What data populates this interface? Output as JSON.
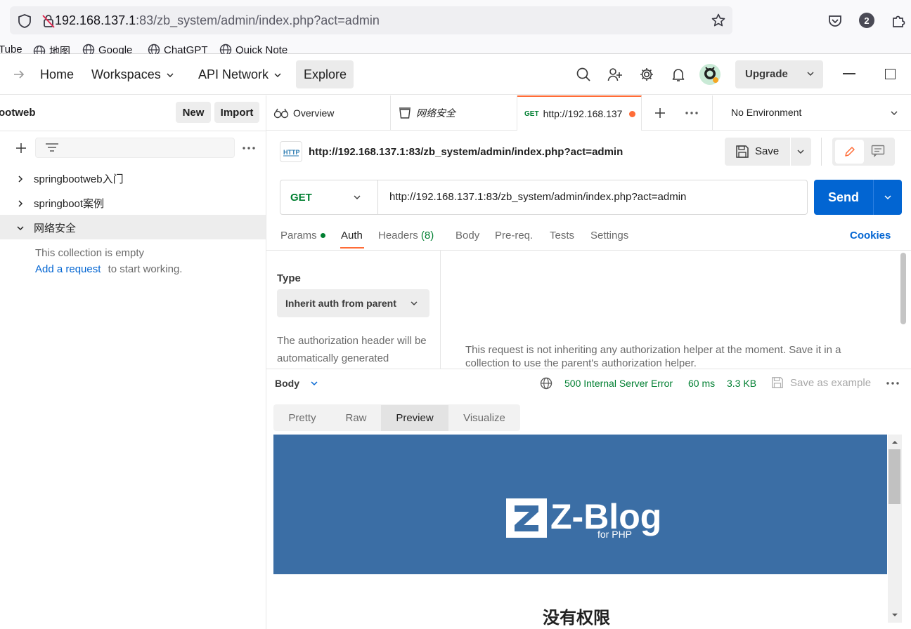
{
  "browser": {
    "url_host": "192.168.137.1",
    "url_rest": ":83/zb_system/admin/index.php?act=admin",
    "notification_count": "2",
    "bookmarks": [
      "Tube",
      "地图",
      "Google",
      "ChatGPT",
      "Quick Note"
    ]
  },
  "nav": {
    "home": "Home",
    "workspaces": "Workspaces",
    "api_network": "API Network",
    "explore": "Explore",
    "upgrade": "Upgrade"
  },
  "sidebar": {
    "workspace_name": "ootweb",
    "new_label": "New",
    "import_label": "Import",
    "items": [
      {
        "label": "springbootweb入门",
        "expanded": false
      },
      {
        "label": "springboot案例",
        "expanded": false
      },
      {
        "label": "网络安全",
        "expanded": true
      }
    ],
    "empty_text": "This collection is empty",
    "add_request": "Add a request",
    "start_text": "to start working."
  },
  "tabs": {
    "overview": "Overview",
    "collection": "网络安全",
    "active_method": "GET",
    "active_label": "http://192.168.137",
    "environment": "No Environment"
  },
  "request": {
    "title": "http://192.168.137.1:83/zb_system/admin/index.php?act=admin",
    "save": "Save",
    "method": "GET",
    "url": "http://192.168.137.1:83/zb_system/admin/index.php?act=admin",
    "send": "Send",
    "tabs": {
      "params": "Params",
      "auth": "Auth",
      "headers": "Headers",
      "headers_count": "(8)",
      "body": "Body",
      "prereq": "Pre-req.",
      "tests": "Tests",
      "settings": "Settings"
    },
    "cookies": "Cookies"
  },
  "auth": {
    "type_label": "Type",
    "type_value": "Inherit auth from parent",
    "desc": "The authorization header will be automatically generated",
    "message": "This request is not inheriting any authorization helper at the moment. Save it in a collection to use the parent's authorization helper."
  },
  "response": {
    "body_label": "Body",
    "status": "500 Internal Server Error",
    "time": "60 ms",
    "size": "3.3 KB",
    "save_example": "Save as example",
    "tabs": [
      "Pretty",
      "Raw",
      "Preview",
      "Visualize"
    ],
    "active_tab": "Preview",
    "logo_text": "Z-Blog",
    "logo_sub": "for PHP",
    "heading": "没有权限"
  },
  "colors": {
    "accent": "#ff6c37",
    "send_blue": "#0265d2",
    "status_green": "#007f31",
    "banner_blue": "#3b6ea5",
    "method_green": "#007f31",
    "link_blue": "#0265d2"
  }
}
